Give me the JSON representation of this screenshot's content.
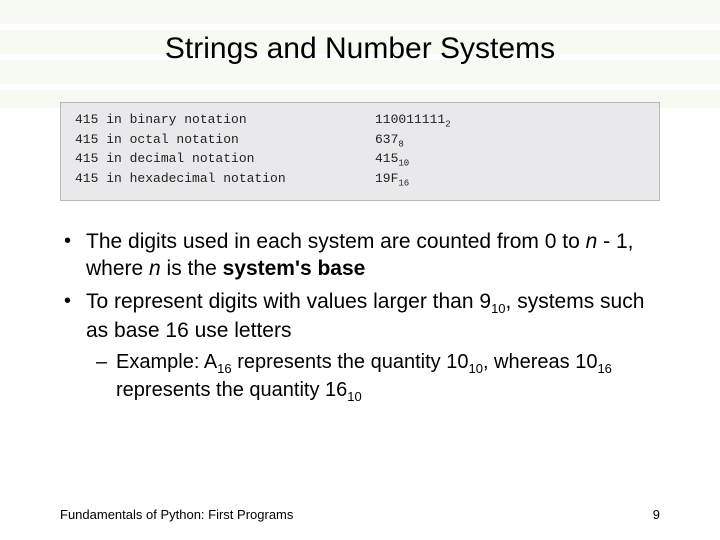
{
  "title": "Strings and Number Systems",
  "codebox": {
    "rows": [
      {
        "lhs": "415 in binary notation",
        "val": "110011111",
        "sub": "2"
      },
      {
        "lhs": "415 in octal notation",
        "val": "637",
        "sub": "8"
      },
      {
        "lhs": "415 in decimal notation",
        "val": "415",
        "sub": "10"
      },
      {
        "lhs": "415 in hexadecimal notation",
        "val": "19F",
        "sub": "16"
      }
    ]
  },
  "bullets": {
    "b1_pre": "The digits used in each system are counted from 0 to ",
    "b1_n1": "n",
    "b1_mid": " - 1, where ",
    "b1_n2": "n",
    "b1_mid2": " is the ",
    "b1_bold": "system's base",
    "b2_pre": "To represent digits with values larger than 9",
    "b2_sub": "10",
    "b2_post": ", systems such as base 16 use letters",
    "ex_pre": "Example: A",
    "ex_s1": "16",
    "ex_mid1": " represents the quantity 10",
    "ex_s2": "10",
    "ex_mid2": ", whereas 10",
    "ex_s3": "16",
    "ex_mid3": " represents the quantity 16",
    "ex_s4": "10"
  },
  "footer": {
    "left": "Fundamentals of Python: First Programs",
    "right": "9"
  }
}
